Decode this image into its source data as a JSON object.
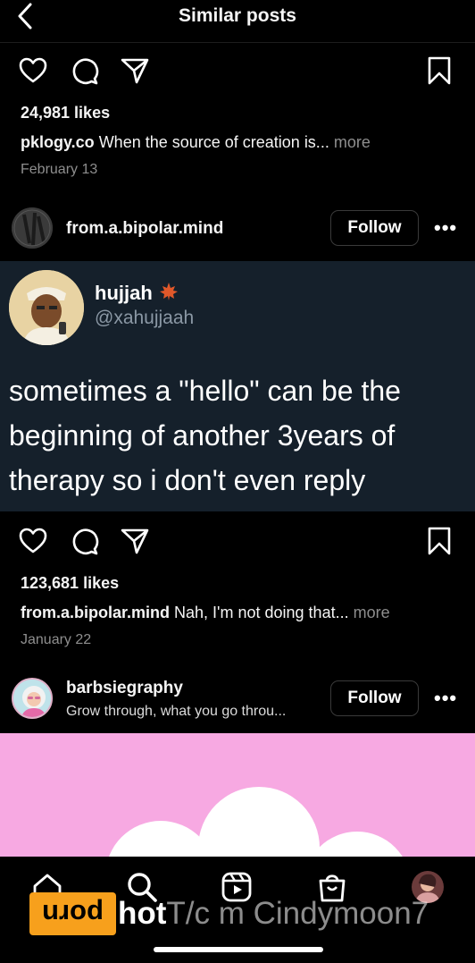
{
  "header": {
    "title": "Similar posts"
  },
  "post1": {
    "likes": "24,981 likes",
    "caption_user": "pklogy.co",
    "caption_text": " When the source of creation is...",
    "caption_more": " more",
    "date": "February 13"
  },
  "post2": {
    "username": "from.a.bipolar.mind",
    "follow_label": "Follow",
    "more_label": "•••",
    "tweet": {
      "name": "hujjah",
      "handle": "@xahujjaah",
      "text": "sometimes a \"hello\" can be the beginning of another 3years of therapy so i don't even reply"
    },
    "likes": "123,681 likes",
    "caption_user": "from.a.bipolar.mind",
    "caption_text": " Nah, I'm not doing that...",
    "caption_more": " more",
    "date": "January 22"
  },
  "post3": {
    "username": "barbsiegraphy",
    "subtitle": "Grow through, what you go throu...",
    "follow_label": "Follow",
    "more_label": "•••"
  },
  "nav": {
    "items": [
      "home-icon",
      "search-icon",
      "reels-icon",
      "shop-icon",
      "profile-avatar"
    ]
  },
  "watermark": {
    "logo_text": "porn",
    "bold_text": "hot",
    "rest_text": "T/c m Cindymoon7"
  },
  "colors": {
    "background": "#000000",
    "tweet_bg": "#15202b",
    "muted": "#8e8e8e",
    "pink": "#f7a9e2"
  }
}
